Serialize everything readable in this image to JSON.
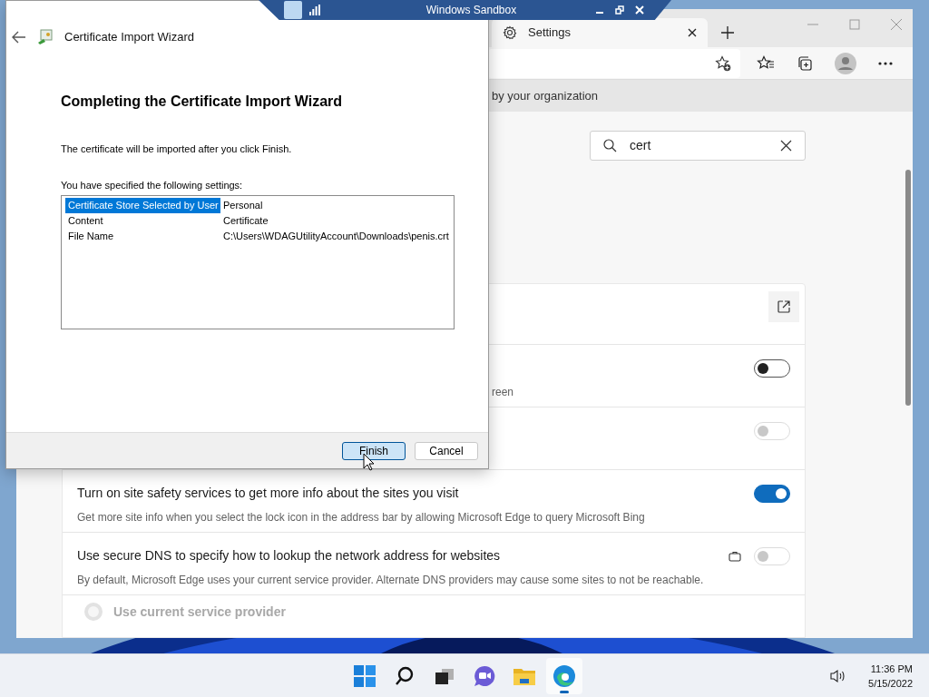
{
  "sandbox_window": {
    "title": "Windows Sandbox"
  },
  "browser": {
    "tab": {
      "label": "Settings",
      "selected": true
    },
    "banner": "by your organization",
    "search": {
      "value": "cert"
    },
    "rows": [
      {
        "kind": "link"
      },
      {
        "kind": "toggle",
        "description": "reen",
        "on": false,
        "disabled": false,
        "managed": false
      },
      {
        "kind": "toggle",
        "on": false,
        "disabled": true,
        "managed": false
      },
      {
        "kind": "toggle",
        "title": "Turn on site safety services to get more info about the sites you visit",
        "description": "Get more site info when you select the lock icon in the address bar by allowing Microsoft Edge to query Microsoft Bing",
        "on": true,
        "disabled": false,
        "managed": false
      },
      {
        "kind": "toggle",
        "title": "Use secure DNS to specify how to lookup the network address for websites",
        "description": "By default, Microsoft Edge uses your current service provider. Alternate DNS providers may cause some sites to not be reachable.",
        "on": false,
        "disabled": true,
        "managed": true
      },
      {
        "kind": "radio",
        "label": "Use current service provider",
        "selected": false,
        "disabled": true
      }
    ]
  },
  "wizard": {
    "title": "Certificate Import Wizard",
    "heading": "Completing the Certificate Import Wizard",
    "intro": "The certificate will be imported after you click Finish.",
    "settings_label": "You have specified the following settings:",
    "settings": [
      {
        "name": "Certificate Store Selected by User",
        "value": "Personal",
        "selected": true
      },
      {
        "name": "Content",
        "value": "Certificate",
        "selected": false
      },
      {
        "name": "File Name",
        "value": "C:\\Users\\WDAGUtilityAccount\\Downloads\\penis.crt",
        "selected": false
      }
    ],
    "buttons": [
      {
        "label": "Finish",
        "default": true
      },
      {
        "label": "Cancel",
        "default": false
      }
    ]
  },
  "taskbar": {
    "apps": [
      {
        "kind": "start",
        "active": false
      },
      {
        "kind": "search",
        "active": false
      },
      {
        "kind": "task-view",
        "active": false
      },
      {
        "kind": "chat",
        "active": false
      },
      {
        "kind": "explorer",
        "active": false
      },
      {
        "kind": "edge",
        "active": true
      }
    ],
    "time": "11:36 PM",
    "date": "5/15/2022"
  }
}
